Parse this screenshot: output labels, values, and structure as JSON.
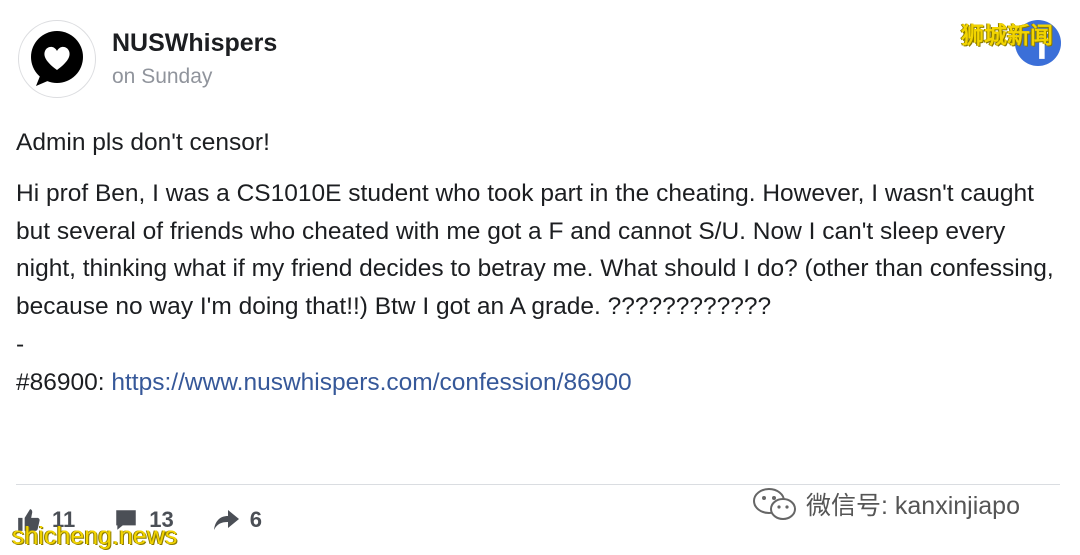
{
  "post": {
    "page_name": "NUSWhispers",
    "timestamp": "on Sunday",
    "title": "Admin pls don't censor!",
    "body": "Hi prof Ben, I was a CS1010E student who took part in the cheating. However, I wasn't caught but several of friends who cheated with me got a F and cannot S/U. Now I can't sleep every night, thinking what if my friend decides to betray me. What should I do? (other than confessing, because no way I'm doing that!!) Btw I got an A grade. ????????????",
    "separator": "-",
    "ref_prefix": "#86900: ",
    "link": "https://www.nuswhispers.com/confession/86900"
  },
  "actions": {
    "likes": "11",
    "comments": "13",
    "shares": "6"
  },
  "watermarks": {
    "top_right": "狮城新闻",
    "bottom_left": "shicheng.news",
    "wechat": "微信号: kanxinjiapo"
  },
  "icons": {
    "avatar": "heart-speech-bubble-icon",
    "badge": "facebook-icon",
    "like": "thumbs-up-icon",
    "comment": "comment-icon",
    "share": "share-arrow-icon",
    "wechat": "wechat-icon"
  },
  "colors": {
    "link": "#365899",
    "facebook_blue": "#3b6fd8",
    "watermark_yellow": "#f2d400",
    "muted_text": "#90949c"
  }
}
